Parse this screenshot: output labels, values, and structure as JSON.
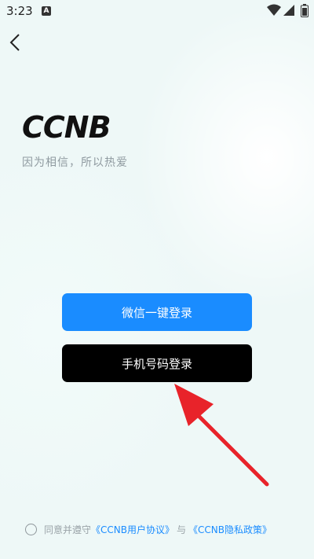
{
  "status": {
    "time": "3:23",
    "notification_badge": "A"
  },
  "header": {
    "back_icon": "chevron-left-icon"
  },
  "brand": {
    "logo_text": "CCNB",
    "slogan": "因为相信，所以热爱"
  },
  "buttons": {
    "wechat_login": "微信一键登录",
    "phone_login": "手机号码登录"
  },
  "agreement": {
    "prefix": "同意并遵守",
    "user_agreement": "《CCNB用户协议》",
    "conjunction": "与",
    "privacy_policy": "《CCNB隐私政策》"
  },
  "colors": {
    "wechat_button": "#1a8cff",
    "phone_button": "#000000",
    "annotation_arrow": "#e8232a",
    "link": "#1a8cff"
  }
}
